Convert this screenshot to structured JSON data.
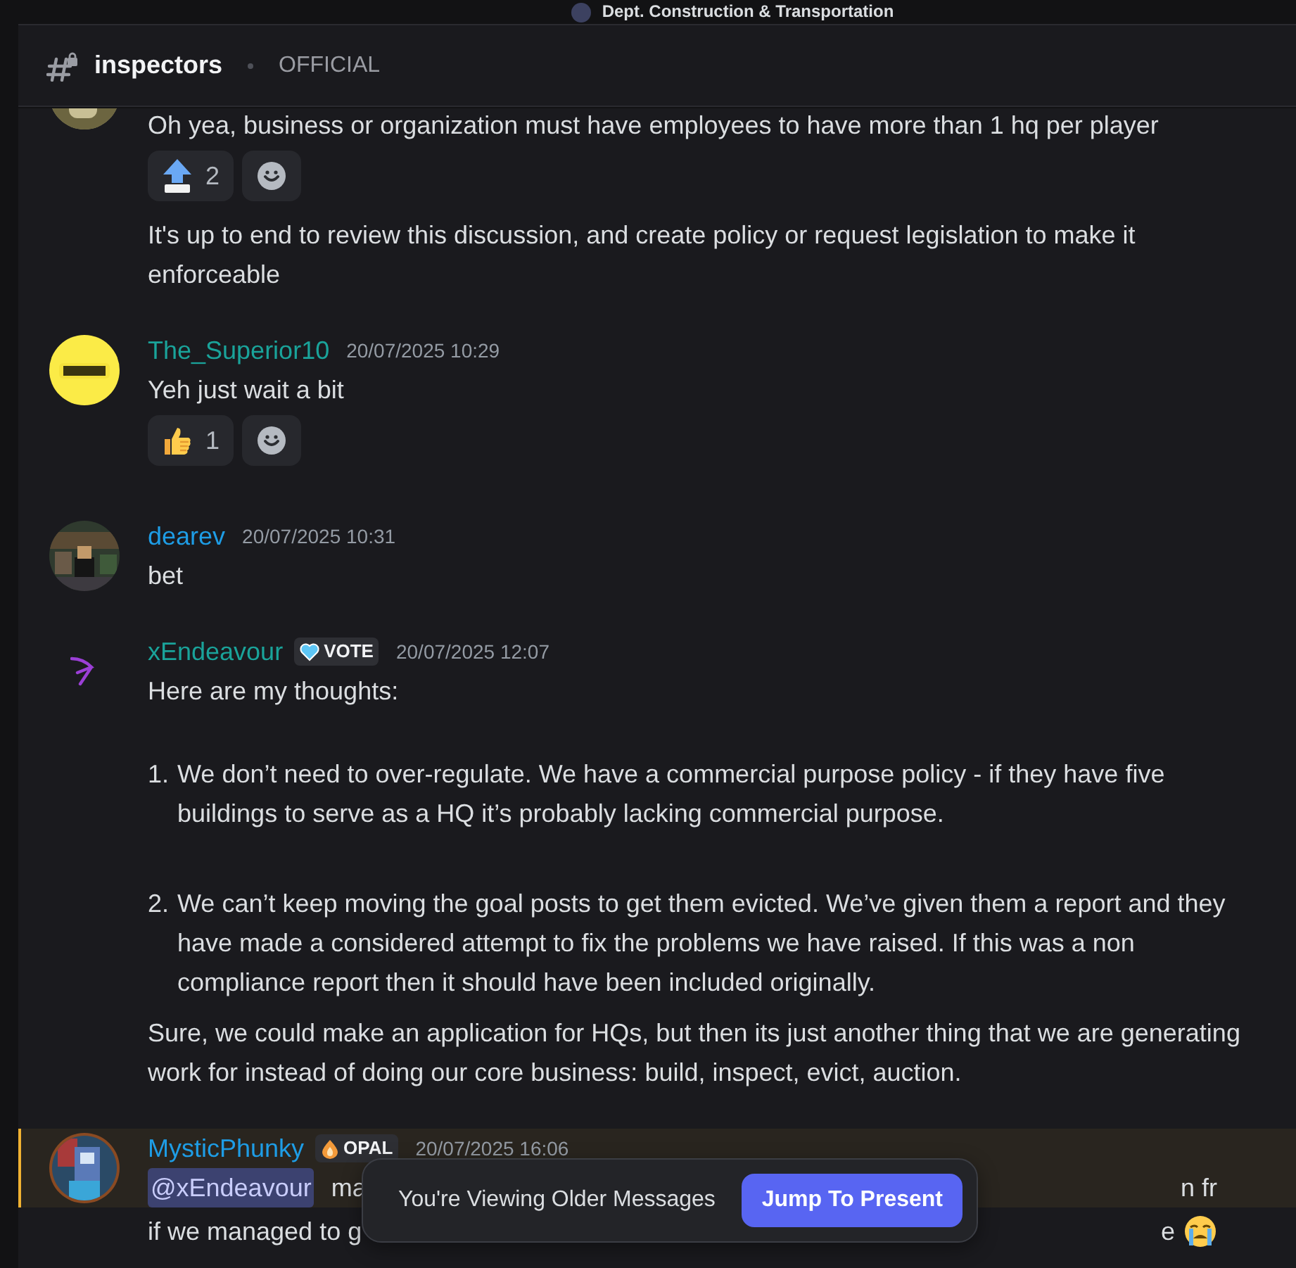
{
  "top_bar": {
    "title": "Dept. Construction & Transportation"
  },
  "channel": {
    "name": "inspectors",
    "tag": "OFFICIAL"
  },
  "messages": [
    {
      "highlighted": false,
      "blocks": [
        {
          "kind": "text",
          "text": "Oh yea, business or organization must have employees to have more than 1 hq per player"
        },
        {
          "kind": "reactions",
          "items": [
            {
              "kind": "up-arrow",
              "count": "2"
            }
          ]
        },
        {
          "kind": "text",
          "text": "It's up to end to review this discussion, and create policy or request legislation to make it enforceable"
        }
      ]
    },
    {
      "author": "The_Superior10",
      "color": "#1aa39a",
      "time": "20/07/2025 10:29",
      "highlighted": false,
      "blocks": [
        {
          "kind": "text",
          "text": "Yeh just wait a bit"
        },
        {
          "kind": "reactions",
          "items": [
            {
              "kind": "thumbs-up",
              "count": "1"
            }
          ]
        }
      ]
    },
    {
      "author": "dearev",
      "color": "#1e9de6",
      "time": "20/07/2025 10:31",
      "highlighted": false,
      "blocks": [
        {
          "kind": "text",
          "text": "bet"
        }
      ]
    },
    {
      "author": "xEndeavour",
      "color": "#1aa39a",
      "badge": {
        "kind": "heart",
        "label": "VOTE"
      },
      "time": "20/07/2025 12:07",
      "highlighted": false,
      "blocks": [
        {
          "kind": "text",
          "text": "Here are my thoughts:"
        },
        {
          "kind": "list",
          "items": [
            {
              "number": "1.",
              "text": "We don’t need to over-regulate.  We have a commercial purpose policy - if they have five buildings to serve as a HQ it’s probably lacking commercial purpose."
            },
            {
              "number": "2.",
              "text": "We can’t keep moving the goal posts to get them evicted. We’ve given them a report and they have made a considered attempt to fix the problems we have raised. If this was a non compliance report then it should have been included originally."
            }
          ]
        },
        {
          "kind": "text",
          "text": "Sure, we could make an application for HQs, but then its just another thing that we are generating work for instead of doing our core business: build, inspect, evict, auction."
        }
      ]
    },
    {
      "author": "MysticPhunky",
      "color": "#1e9de6",
      "badge": {
        "kind": "drop",
        "label": "OPAL"
      },
      "time": "20/07/2025 16:06",
      "highlighted": true,
      "blocks": [
        {
          "kind": "split",
          "start": [
            {
              "kind": "mention",
              "text": "@xEndeavour"
            },
            {
              "kind": "text",
              "text": "ma"
            }
          ],
          "end": [
            {
              "kind": "text",
              "text": "n fr"
            }
          ]
        }
      ]
    },
    {
      "highlighted": false,
      "blocks": [
        {
          "kind": "split",
          "start": [
            {
              "kind": "text",
              "text": "if we managed to g"
            }
          ],
          "end": [
            {
              "kind": "text",
              "text": "e"
            },
            {
              "kind": "emoji"
            }
          ]
        }
      ]
    }
  ],
  "toast": {
    "text": "You're Viewing Older Messages",
    "button": "Jump To Present"
  }
}
